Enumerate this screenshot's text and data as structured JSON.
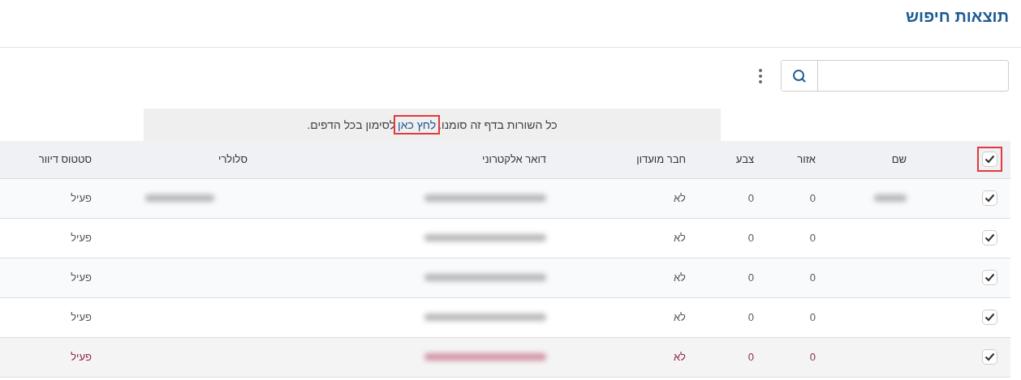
{
  "title": "תוצאות חיפוש",
  "banner": {
    "before": "כל השורות בדף זה סומנו.",
    "link": "לחץ כאן",
    "after": "לסימון בכל הדפים.",
    "link_highlighted": true
  },
  "table": {
    "select_all": {
      "checked": true,
      "highlighted": true
    },
    "columns": [
      "שם",
      "אזור",
      "צבע",
      "חבר מועדון",
      "דואר אלקטרוני",
      "סלולרי",
      "סטטוס דיוור"
    ],
    "rows": [
      {
        "checked": true,
        "hovered": false,
        "name_blurred": true,
        "area": "0",
        "color_value": "0",
        "club_member": "לא",
        "email_blurred": true,
        "phone_blurred": true,
        "status": "פעיל"
      },
      {
        "checked": true,
        "hovered": false,
        "name_blurred": false,
        "area": "0",
        "color_value": "0",
        "club_member": "לא",
        "email_blurred": true,
        "phone_blurred": false,
        "status": "פעיל"
      },
      {
        "checked": true,
        "hovered": false,
        "name_blurred": false,
        "area": "0",
        "color_value": "0",
        "club_member": "לא",
        "email_blurred": true,
        "phone_blurred": false,
        "status": "פעיל"
      },
      {
        "checked": true,
        "hovered": false,
        "name_blurred": false,
        "area": "0",
        "color_value": "0",
        "club_member": "לא",
        "email_blurred": true,
        "phone_blurred": false,
        "status": "פעיל"
      },
      {
        "checked": true,
        "hovered": true,
        "name_blurred": false,
        "area": "0",
        "color_value": "0",
        "club_member": "לא",
        "email_blurred": true,
        "phone_blurred": false,
        "status": "פעיל"
      }
    ]
  }
}
